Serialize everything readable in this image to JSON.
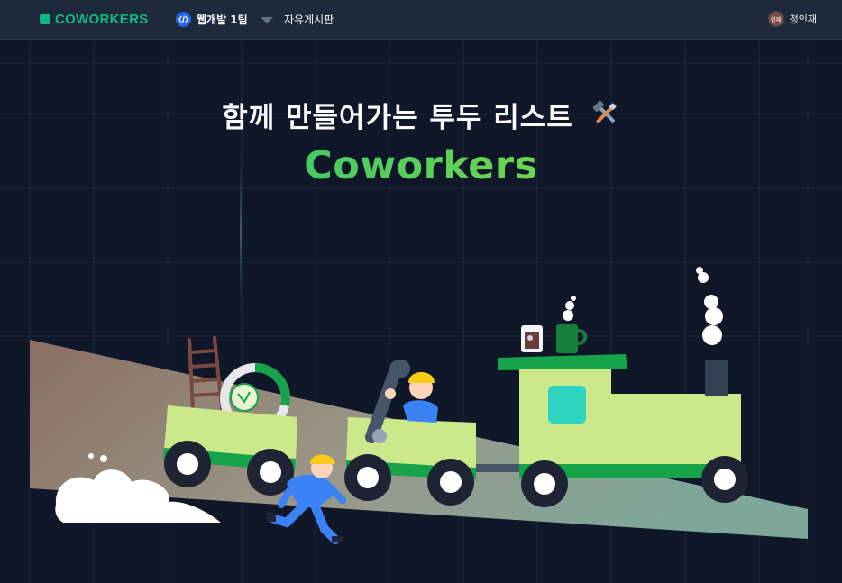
{
  "navbar": {
    "logo_text": "COWORKERS",
    "team_name": "웹개발 1팀",
    "board_link": "자유게시판",
    "user": {
      "avatar_text": "인재",
      "name": "정인재"
    }
  },
  "hero": {
    "title": "함께 만들어가는 투두 리스트",
    "title_icon": "tools-icon",
    "brand": "Coworkers"
  },
  "colors": {
    "background": "#0f1729",
    "navbar": "#1e293b",
    "brand_green": "#10b981",
    "brand_lime": "#a3e635",
    "team_icon_blue": "#2563eb",
    "train_body": "#cbe98a",
    "train_stripe": "#16a34a"
  }
}
